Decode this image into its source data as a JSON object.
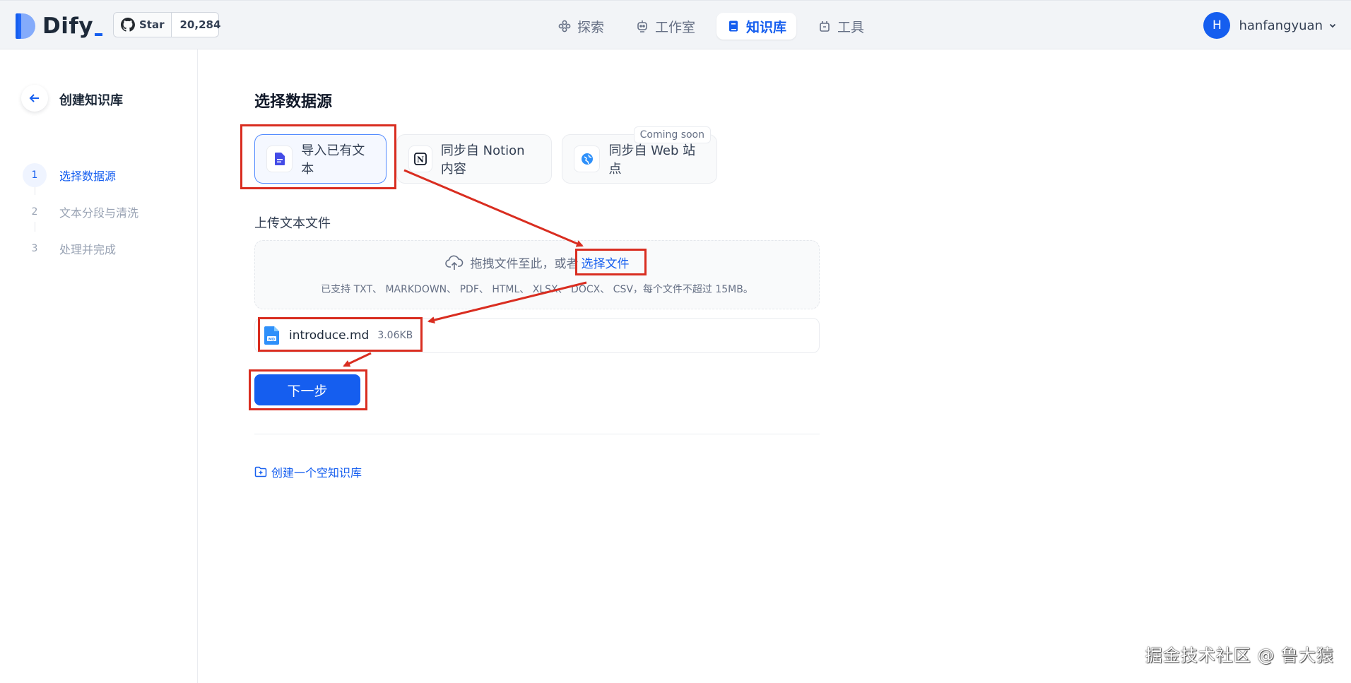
{
  "header": {
    "logo_text": "Dify",
    "github": {
      "label": "Star",
      "count": "20,284"
    },
    "nav": [
      {
        "label": "探索",
        "icon": "explore-icon",
        "active": false
      },
      {
        "label": "工作室",
        "icon": "studio-robot-icon",
        "active": false
      },
      {
        "label": "知识库",
        "icon": "knowledge-book-icon",
        "active": true
      },
      {
        "label": "工具",
        "icon": "tools-icon",
        "active": false
      }
    ],
    "user": {
      "avatar_letter": "H",
      "name": "hanfangyuan"
    }
  },
  "sidebar": {
    "title": "创建知识库",
    "steps": [
      {
        "num": "1",
        "label": "选择数据源",
        "active": true
      },
      {
        "num": "2",
        "label": "文本分段与清洗",
        "active": false
      },
      {
        "num": "3",
        "label": "处理并完成",
        "active": false
      }
    ]
  },
  "main": {
    "section_title": "选择数据源",
    "sources": [
      {
        "label": "导入已有文本",
        "icon": "document-icon",
        "active": true
      },
      {
        "label": "同步自 Notion 内容",
        "icon": "notion-icon",
        "active": false
      },
      {
        "label": "同步自 Web 站点",
        "icon": "web-icon",
        "active": false,
        "badge": "Coming soon"
      }
    ],
    "upload_label": "上传文本文件",
    "dropzone": {
      "text": "拖拽文件至此，或者",
      "link": "选择文件",
      "hint": "已支持 TXT、 MARKDOWN、 PDF、 HTML、 XLSX、 DOCX、 CSV，每个文件不超过 15MB。"
    },
    "file": {
      "name": "introduce.md",
      "size": "3.06KB"
    },
    "next_button": "下一步",
    "create_empty": "创建一个空知识库"
  },
  "watermark": "掘金技术社区 @ 鲁大猿",
  "colors": {
    "accent": "#155eef",
    "annotation": "#d92d20",
    "topbar_bg": "#f2f4f7"
  }
}
